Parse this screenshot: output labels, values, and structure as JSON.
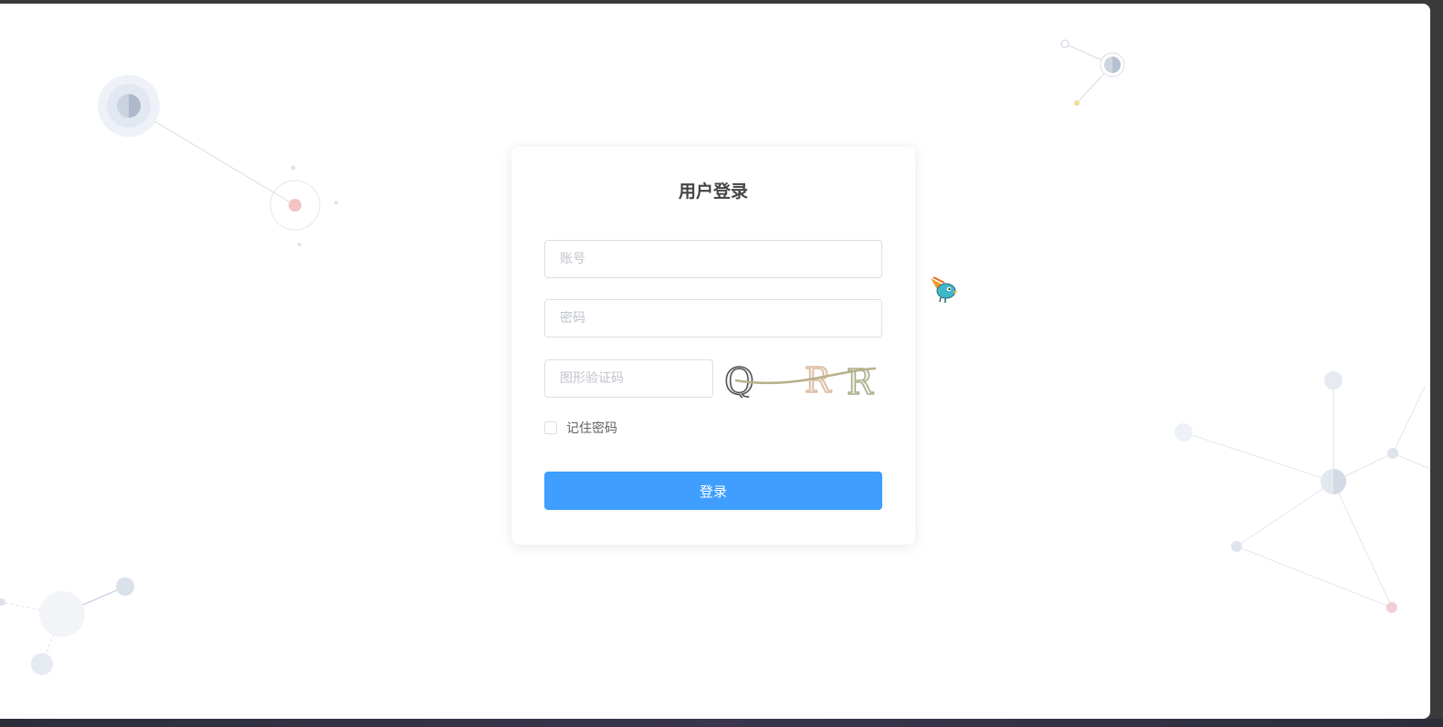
{
  "login": {
    "title": "用户登录",
    "account_placeholder": "账号",
    "password_placeholder": "密码",
    "captcha_placeholder": "图形验证码",
    "captcha_image_text": "Q R R",
    "remember_label": "记住密码",
    "remember_checked": false,
    "submit_label": "登录"
  },
  "colors": {
    "primary": "#409eff",
    "background": "#ffffff",
    "border": "#dcdfe6",
    "placeholder": "#c0c4cc"
  },
  "icons": {
    "checkbox": "checkbox-unchecked-icon",
    "mascot": "bird-mascot-icon"
  }
}
